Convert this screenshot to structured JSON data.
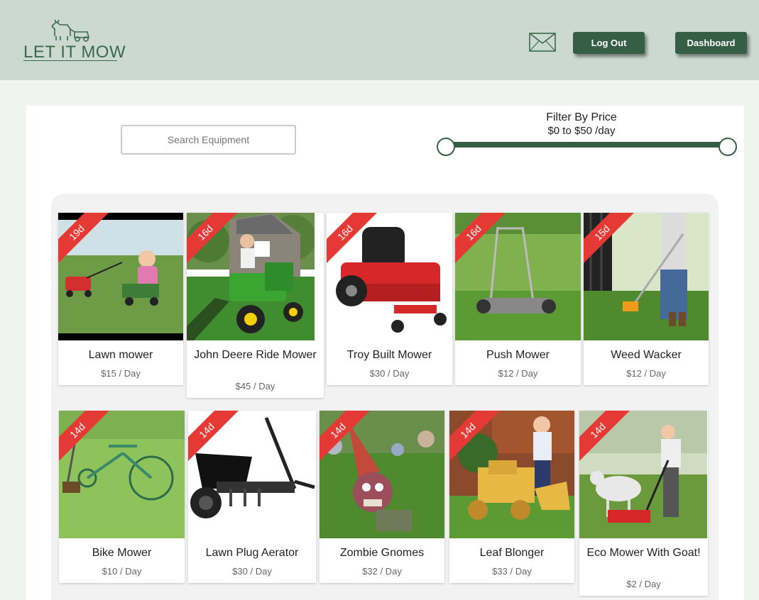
{
  "header": {
    "logo_text": "LET IT MOW",
    "logout_label": "Log Out",
    "dashboard_label": "Dashboard"
  },
  "search": {
    "placeholder": "Search Equipment"
  },
  "filter": {
    "title": "Filter By Price",
    "range_text": "$0 to $50 /day",
    "min": 0,
    "max": 50
  },
  "colors": {
    "brand": "#355e44",
    "header_bg": "#ccd9d1",
    "ribbon": "#e53935"
  },
  "listings": [
    {
      "name": "Lawn mower",
      "price": "$15 / Day",
      "days": "19d",
      "icon": "push-mower-photo"
    },
    {
      "name": "John Deere Ride Mower",
      "price": "$45 / Day",
      "days": "16d",
      "icon": "riding-mower-photo"
    },
    {
      "name": "Troy Built Mower",
      "price": "$30 / Day",
      "days": "16d",
      "icon": "zero-turn-mower-photo"
    },
    {
      "name": "Push Mower",
      "price": "$12 / Day",
      "days": "16d",
      "icon": "reel-mower-photo"
    },
    {
      "name": "Weed Wacker",
      "price": "$12 / Day",
      "days": "15d",
      "icon": "string-trimmer-photo"
    },
    {
      "name": "Bike Mower",
      "price": "$10 / Day",
      "days": "14d",
      "icon": "bike-mower-photo"
    },
    {
      "name": "Lawn Plug Aerator",
      "price": "$30 / Day",
      "days": "14d",
      "icon": "aerator-photo"
    },
    {
      "name": "Zombie Gnomes",
      "price": "$32 / Day",
      "days": "14d",
      "icon": "gnome-photo"
    },
    {
      "name": "Leaf Blonger",
      "price": "$33 / Day",
      "days": "14d",
      "icon": "wooden-loader-photo"
    },
    {
      "name": "Eco Mower With Goat!",
      "price": "$2 / Day",
      "days": "14d",
      "icon": "goat-mower-photo"
    }
  ]
}
